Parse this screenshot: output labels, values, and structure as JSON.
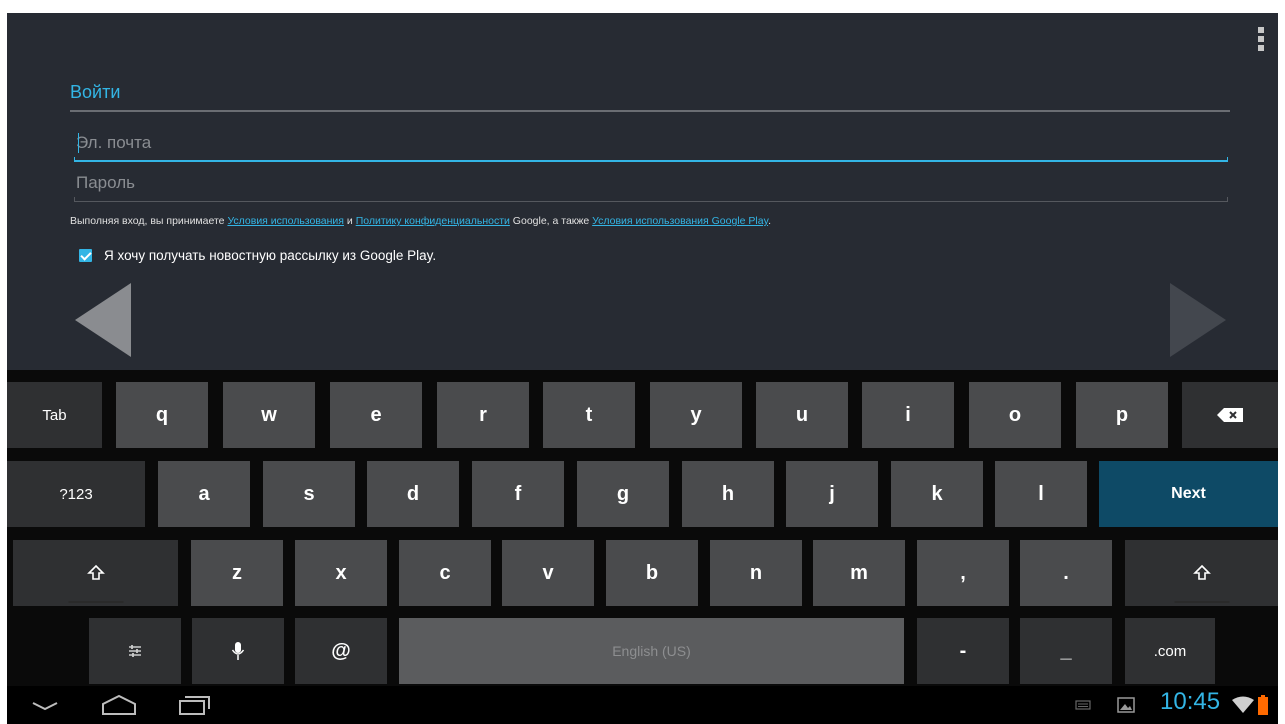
{
  "signin": {
    "title": "Войти",
    "email_placeholder": "Эл. почта",
    "email_value": "",
    "password_placeholder": "Пароль",
    "password_value": ""
  },
  "terms": {
    "text_before": "Выполняя вход, вы принимаете ",
    "link_terms": "Условия использования",
    "text_and": " и ",
    "link_privacy": "Политику конфиденциальности",
    "text_google_also": " Google, а также ",
    "link_play_terms": "Условия использования Google Play",
    "text_end": "."
  },
  "newsletter": {
    "checked": true,
    "label": "Я хочу получать новостную рассылку из Google Play."
  },
  "keyboard": {
    "row1": [
      "Tab",
      "q",
      "w",
      "e",
      "r",
      "t",
      "y",
      "u",
      "i",
      "o",
      "p"
    ],
    "row2": [
      "?123",
      "a",
      "s",
      "d",
      "f",
      "g",
      "h",
      "j",
      "k",
      "l",
      "Next"
    ],
    "row3": [
      "z",
      "x",
      "c",
      "v",
      "b",
      "n",
      "m",
      ",",
      "."
    ],
    "row4": [
      "@",
      "English (US)",
      "-",
      "_",
      ".com"
    ],
    "backspace_icon": "backspace-icon",
    "shift_icon": "shift-icon",
    "settings_icon": "settings-sliders-icon",
    "mic_icon": "microphone-icon"
  },
  "system_bar": {
    "time": "10:45",
    "icons": [
      "hide-keyboard-icon",
      "home-icon",
      "recent-apps-icon",
      "keyboard-status-icon",
      "gallery-icon",
      "wifi-icon",
      "battery-icon"
    ]
  },
  "colors": {
    "accent": "#33b5e5",
    "background": "#272b33",
    "key": "#4a4b4d",
    "next_key": "#0e4a66"
  }
}
